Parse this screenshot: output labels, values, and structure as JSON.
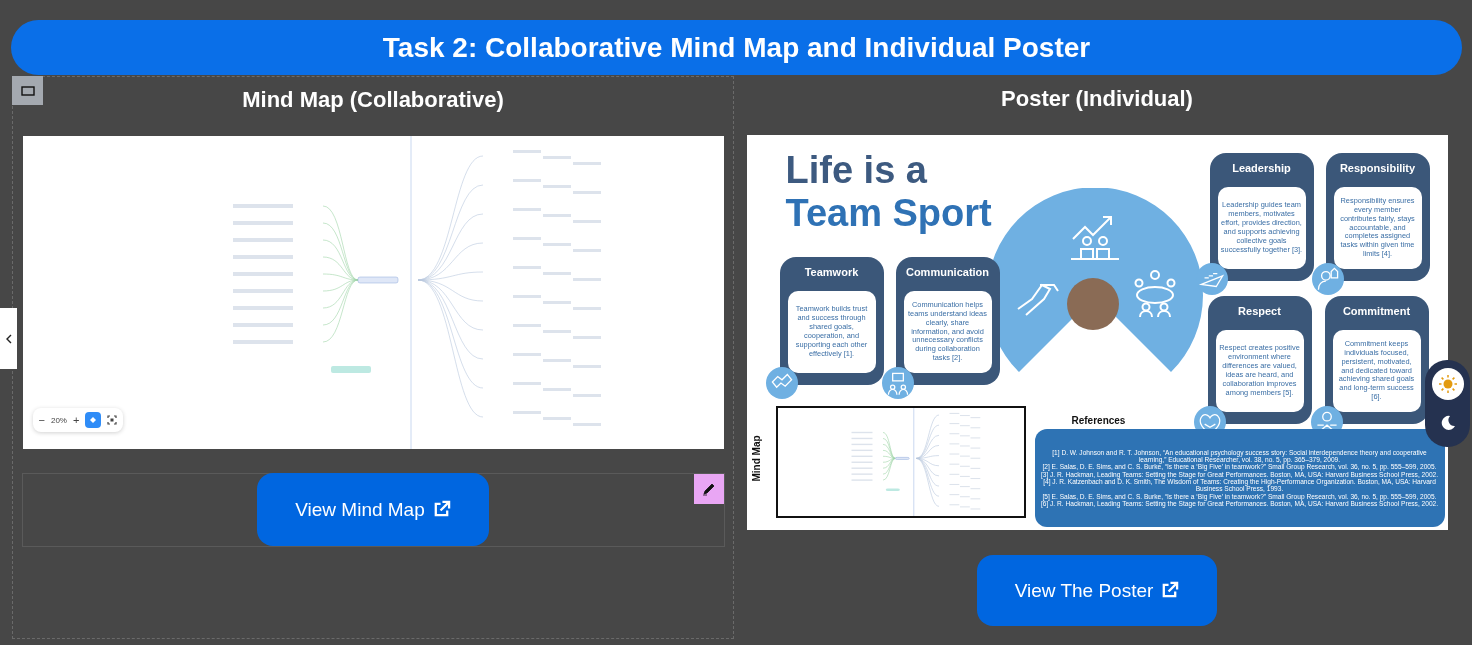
{
  "header": {
    "title": "Task 2: Collaborative Mind Map and Individual Poster"
  },
  "mind_map_panel": {
    "heading": "Mind Map (Collaborative)",
    "zoom_controls": {
      "zoom_out": "−",
      "zoom": "20%",
      "zoom_in": "+"
    },
    "button": "View Mind Map"
  },
  "poster_panel": {
    "heading": "Poster (Individual)",
    "poster": {
      "title_line_1": "Life is a",
      "title_line_2": "Team Sport",
      "cards": [
        {
          "title": "Teamwork",
          "text": "Teamwork builds trust and success through shared goals, cooperation, and supporting each other effectively [1]."
        },
        {
          "title": "Communication",
          "text": "Communication helps teams understand ideas clearly, share information, and avoid unnecessary conflicts during collaboration tasks [2]."
        },
        {
          "title": "Leadership",
          "text": "Leadership guides team members, motivates effort, provides direction, and supports achieving collective goals successfully together [3]."
        },
        {
          "title": "Responsibility",
          "text": "Responsibility ensures every member contributes fairly, stays accountable, and completes assigned tasks within given time limits [4]."
        },
        {
          "title": "Respect",
          "text": "Respect creates positive environment where differences are valued, ideas are heard, and collaboration improves among members [5]."
        },
        {
          "title": "Commitment",
          "text": "Commitment keeps individuals focused, persistent, motivated, and dedicated toward achieving shared goals and long-term success [6]."
        }
      ],
      "inset_label": "Mind Map",
      "references_heading": "References",
      "references": [
        "[1] D. W. Johnson and R. T. Johnson, “An educational psychology success story: Social interdependence theory and cooperative learning,” Educational Researcher, vol. 38, no. 5, pp. 365–379, 2009.",
        "[2] E. Salas, D. E. Sims, and C. S. Burke, “Is there a ‘Big Five’ in teamwork?” Small Group Research, vol. 36, no. 5, pp. 555–599, 2005.",
        "[3] J. R. Hackman, Leading Teams: Setting the Stage for Great Performances. Boston, MA, USA: Harvard Business School Press, 2002.",
        "[4] J. R. Katzenbach and D. K. Smith, The Wisdom of Teams: Creating the High-Performance Organization. Boston, MA, USA: Harvard Business School Press, 1993.",
        "[5] E. Salas, D. E. Sims, and C. S. Burke, “Is there a ‘Big Five’ in teamwork?” Small Group Research, vol. 36, no. 5, pp. 555–599, 2005.",
        "[6] J. R. Hackman, Leading Teams: Setting the Stage for Great Performances. Boston, MA, USA: Harvard Business School Press, 2002."
      ]
    },
    "button": "View The Poster"
  },
  "theme_toggle": {
    "options": [
      {
        "kind": "light",
        "selected": true
      },
      {
        "kind": "dark",
        "selected": false
      }
    ]
  }
}
